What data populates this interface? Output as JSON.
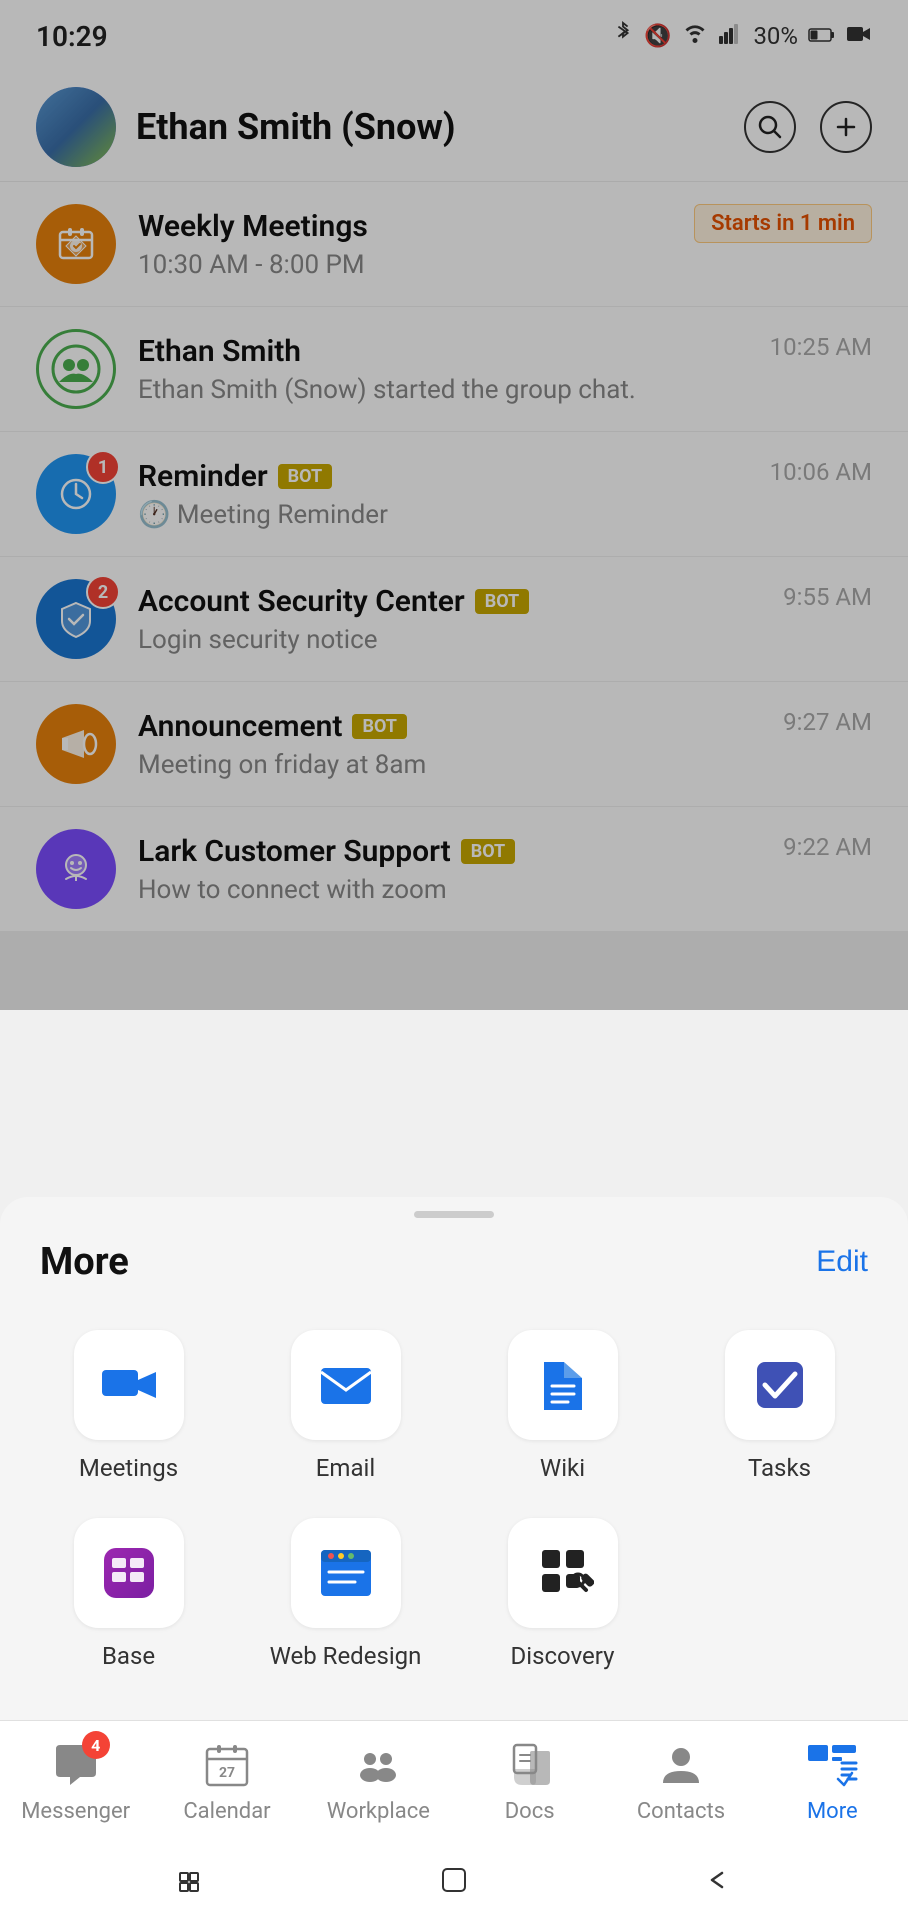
{
  "statusBar": {
    "time": "10:29",
    "battery": "30%"
  },
  "header": {
    "userName": "Ethan Smith (Snow)",
    "searchLabel": "Search",
    "addLabel": "Add"
  },
  "chatList": [
    {
      "id": "weekly-meetings",
      "name": "Weekly Meetings",
      "preview": "10:30 AM - 8:00 PM",
      "badge": "Starts in 1 min",
      "badgeType": "starts",
      "avatarType": "orange",
      "avatarIcon": "📅",
      "time": ""
    },
    {
      "id": "ethan-smith",
      "name": "Ethan Smith",
      "preview": "Ethan Smith (Snow) started the group chat.",
      "avatarType": "green",
      "avatarIcon": "👥",
      "time": "10:25 AM",
      "bot": false
    },
    {
      "id": "reminder",
      "name": "Reminder",
      "preview": "🕐 Meeting Reminder",
      "avatarType": "blue",
      "avatarIcon": "⏰",
      "time": "10:06 AM",
      "bot": true,
      "badgeCount": 1
    },
    {
      "id": "account-security",
      "name": "Account Security Center",
      "preview": "Login security notice",
      "avatarType": "blue2",
      "avatarIcon": "🛡",
      "time": "9:55 AM",
      "bot": true,
      "badgeCount": 2
    },
    {
      "id": "announcement",
      "name": "Announcement",
      "preview": "Meeting on friday at 8am",
      "avatarType": "orange2",
      "avatarIcon": "📢",
      "time": "9:27 AM",
      "bot": true
    },
    {
      "id": "lark-support",
      "name": "Lark Customer Support",
      "preview": "How to connect with zoom",
      "avatarType": "purple",
      "avatarIcon": "🤖",
      "time": "9:22 AM",
      "bot": true
    }
  ],
  "bottomSheet": {
    "title": "More",
    "editLabel": "Edit",
    "apps": [
      {
        "id": "meetings",
        "label": "Meetings",
        "iconType": "meetings"
      },
      {
        "id": "email",
        "label": "Email",
        "iconType": "email"
      },
      {
        "id": "wiki",
        "label": "Wiki",
        "iconType": "wiki"
      },
      {
        "id": "tasks",
        "label": "Tasks",
        "iconType": "tasks"
      },
      {
        "id": "base",
        "label": "Base",
        "iconType": "base"
      },
      {
        "id": "web-redesign",
        "label": "Web Redesign",
        "iconType": "web"
      },
      {
        "id": "discovery",
        "label": "Discovery",
        "iconType": "discovery"
      }
    ]
  },
  "bottomNav": {
    "items": [
      {
        "id": "messenger",
        "label": "Messenger",
        "badge": 4,
        "active": false
      },
      {
        "id": "calendar",
        "label": "Calendar",
        "badge": 0,
        "active": false
      },
      {
        "id": "workplace",
        "label": "Workplace",
        "badge": 0,
        "active": false
      },
      {
        "id": "docs",
        "label": "Docs",
        "badge": 0,
        "active": false
      },
      {
        "id": "contacts",
        "label": "Contacts",
        "badge": 0,
        "active": false
      },
      {
        "id": "more",
        "label": "More",
        "badge": 0,
        "active": true
      }
    ]
  }
}
